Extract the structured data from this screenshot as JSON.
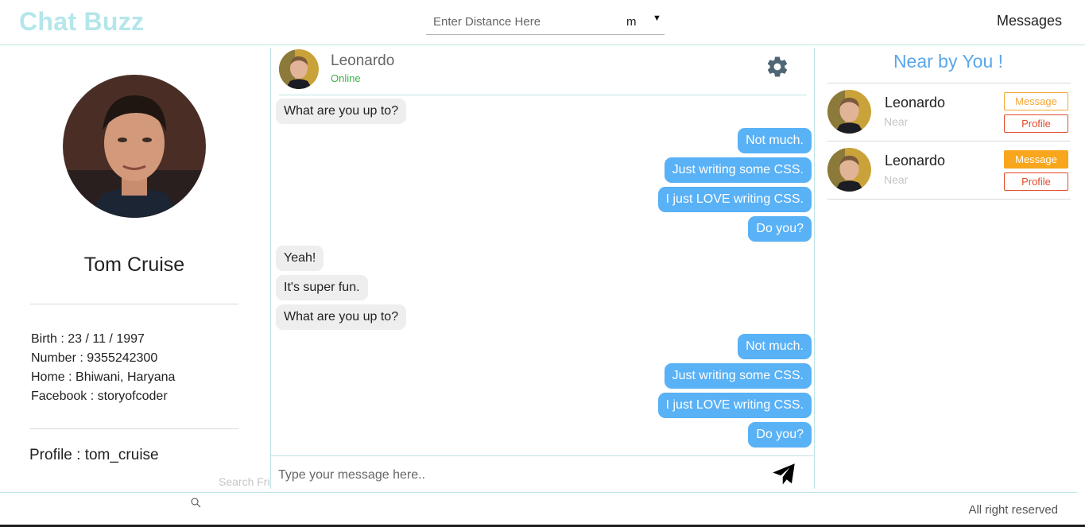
{
  "header": {
    "brand": "Chat Buzz",
    "distance_placeholder": "Enter Distance Here",
    "unit": "m",
    "messages_link": "Messages"
  },
  "profile": {
    "name": "Tom Cruise",
    "birth": "Birth : 23 / 11 / 1997",
    "number": "Number : 9355242300",
    "home": "Home : Bhiwani, Haryana",
    "facebook": "Facebook : storyofcoder",
    "handle": "Profile : tom_cruise"
  },
  "chat": {
    "contact_name": "Leonardo",
    "status": "Online",
    "composer_placeholder": "Type your message here..",
    "messages": [
      {
        "side": "in",
        "text": "What are you up to?"
      },
      {
        "side": "out",
        "text": "Not much."
      },
      {
        "side": "out",
        "text": "Just writing some CSS."
      },
      {
        "side": "out",
        "text": "I just LOVE writing CSS."
      },
      {
        "side": "out",
        "text": "Do you?"
      },
      {
        "side": "in",
        "text": "Yeah!"
      },
      {
        "side": "in",
        "text": "It's super fun."
      },
      {
        "side": "in",
        "text": "What are you up to?"
      },
      {
        "side": "out",
        "text": "Not much."
      },
      {
        "side": "out",
        "text": "Just writing some CSS."
      },
      {
        "side": "out",
        "text": "I just LOVE writing CSS."
      },
      {
        "side": "out",
        "text": "Do you?"
      }
    ]
  },
  "search": {
    "placeholder": "Search Fri"
  },
  "nearby": {
    "title": "Near by You !",
    "people": [
      {
        "name": "Leonardo",
        "distance": "Near",
        "message_label": "Message",
        "profile_label": "Profile",
        "message_active": false
      },
      {
        "name": "Leonardo",
        "distance": "Near",
        "message_label": "Message",
        "profile_label": "Profile",
        "message_active": true
      }
    ]
  },
  "footer": {
    "text": "All right reserved"
  },
  "colors": {
    "brand": "#b4e6ea",
    "accent_blue": "#59b1f6",
    "online": "#3bb34a",
    "message_orange": "#f8a61b",
    "profile_red": "#e04b2a"
  }
}
